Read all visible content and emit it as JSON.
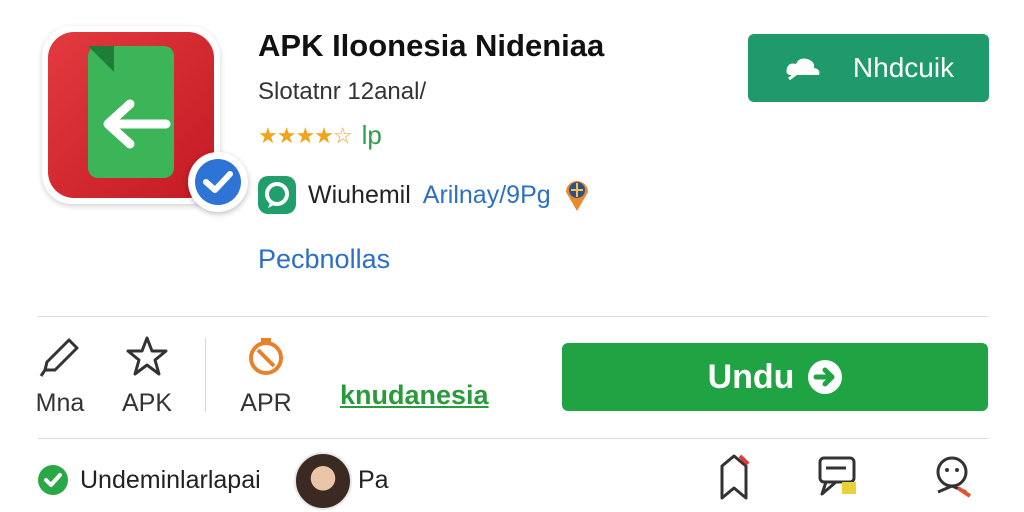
{
  "app": {
    "title": "APK Iloonesia Nideniaa",
    "subtitle": "Slotatnr  12anal/",
    "rating_text": "lp",
    "developer_name": "Wiuhemil",
    "developer_link": "Arilnay/9Pg",
    "details_link": "Pecbnollas",
    "icon_name": "app-icon"
  },
  "header": {
    "top_button_label": "Nhdcuik",
    "top_button_icon": "cloud-icon",
    "top_button_color": "#1f9a6b"
  },
  "actions": [
    {
      "label": "Mna",
      "icon": "pencil-icon"
    },
    {
      "label": "APK",
      "icon": "star-icon"
    },
    {
      "label": "APR",
      "icon": "timer-icon"
    }
  ],
  "region_link": "knudanesia",
  "download_button": {
    "label": "Undu",
    "icon": "arrow-right-icon",
    "color": "#1fa343"
  },
  "bottom": {
    "verified_text": "Undeminlarlapai",
    "user_text": "Pa",
    "icons": [
      "pin-icon",
      "chat-icon",
      "support-icon"
    ]
  },
  "colors": {
    "accent_green": "#2a9b3d",
    "link_blue": "#2c6fc4",
    "star": "#f2a31c"
  }
}
